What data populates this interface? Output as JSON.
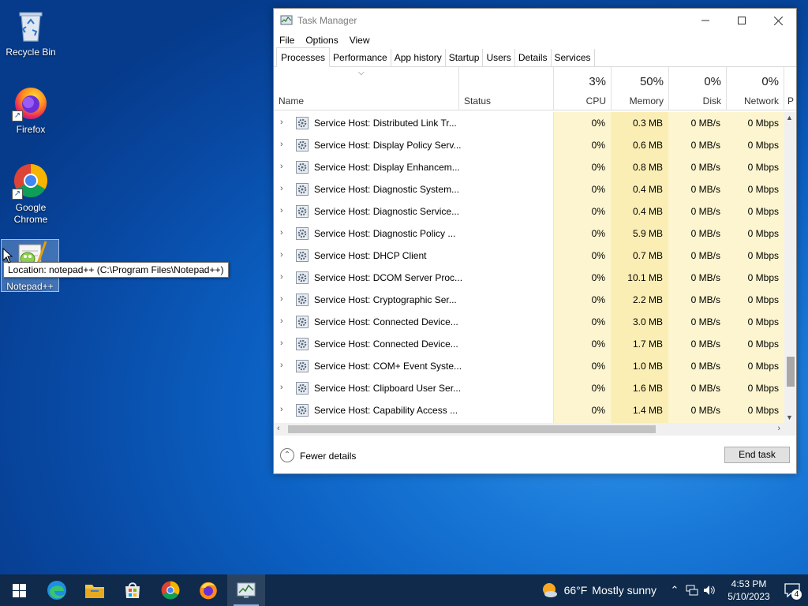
{
  "desktop": {
    "icons": [
      {
        "label": "Recycle Bin"
      },
      {
        "label": "Firefox"
      },
      {
        "label": "Google Chrome"
      },
      {
        "label": "Notepad++"
      }
    ],
    "tooltip": "Location: notepad++ (C:\\Program Files\\Notepad++)"
  },
  "taskmanager": {
    "title": "Task Manager",
    "menu": [
      "File",
      "Options",
      "View"
    ],
    "tabs": [
      "Processes",
      "Performance",
      "App history",
      "Startup",
      "Users",
      "Details",
      "Services"
    ],
    "active_tab": "Processes",
    "columns": {
      "name": "Name",
      "status": "Status",
      "cpu": {
        "pct": "3%",
        "label": "CPU"
      },
      "memory": {
        "pct": "50%",
        "label": "Memory"
      },
      "disk": {
        "pct": "0%",
        "label": "Disk"
      },
      "network": {
        "pct": "0%",
        "label": "Network"
      },
      "power": {
        "label": "P"
      }
    },
    "rows": [
      {
        "name": "Service Host: Distributed Link Tr...",
        "cpu": "0%",
        "memory": "0.3 MB",
        "disk": "0 MB/s",
        "network": "0 Mbps"
      },
      {
        "name": "Service Host: Display Policy Serv...",
        "cpu": "0%",
        "memory": "0.6 MB",
        "disk": "0 MB/s",
        "network": "0 Mbps"
      },
      {
        "name": "Service Host: Display Enhancem...",
        "cpu": "0%",
        "memory": "0.8 MB",
        "disk": "0 MB/s",
        "network": "0 Mbps"
      },
      {
        "name": "Service Host: Diagnostic System...",
        "cpu": "0%",
        "memory": "0.4 MB",
        "disk": "0 MB/s",
        "network": "0 Mbps"
      },
      {
        "name": "Service Host: Diagnostic Service...",
        "cpu": "0%",
        "memory": "0.4 MB",
        "disk": "0 MB/s",
        "network": "0 Mbps"
      },
      {
        "name": "Service Host: Diagnostic Policy ...",
        "cpu": "0%",
        "memory": "5.9 MB",
        "disk": "0 MB/s",
        "network": "0 Mbps"
      },
      {
        "name": "Service Host: DHCP Client",
        "cpu": "0%",
        "memory": "0.7 MB",
        "disk": "0 MB/s",
        "network": "0 Mbps"
      },
      {
        "name": "Service Host: DCOM Server Proc...",
        "cpu": "0%",
        "memory": "10.1 MB",
        "disk": "0 MB/s",
        "network": "0 Mbps"
      },
      {
        "name": "Service Host: Cryptographic Ser...",
        "cpu": "0%",
        "memory": "2.2 MB",
        "disk": "0 MB/s",
        "network": "0 Mbps"
      },
      {
        "name": "Service Host: Connected Device...",
        "cpu": "0%",
        "memory": "3.0 MB",
        "disk": "0 MB/s",
        "network": "0 Mbps"
      },
      {
        "name": "Service Host: Connected Device...",
        "cpu": "0%",
        "memory": "1.7 MB",
        "disk": "0 MB/s",
        "network": "0 Mbps"
      },
      {
        "name": "Service Host: COM+ Event Syste...",
        "cpu": "0%",
        "memory": "1.0 MB",
        "disk": "0 MB/s",
        "network": "0 Mbps"
      },
      {
        "name": "Service Host: Clipboard User Ser...",
        "cpu": "0%",
        "memory": "1.6 MB",
        "disk": "0 MB/s",
        "network": "0 Mbps"
      },
      {
        "name": "Service Host: Capability Access ...",
        "cpu": "0%",
        "memory": "1.4 MB",
        "disk": "0 MB/s",
        "network": "0 Mbps"
      }
    ],
    "footer": {
      "fewer_details": "Fewer details",
      "end_task": "End task"
    }
  },
  "taskbar": {
    "apps": [
      "start-icon",
      "edge-icon",
      "file-explorer-icon",
      "store-icon",
      "chrome-icon",
      "firefox-icon",
      "task-manager-icon"
    ],
    "weather": {
      "temp": "66°F",
      "condition": "Mostly sunny"
    },
    "time": "4:53 PM",
    "date": "5/10/2023",
    "notification_count": "4"
  },
  "colors": {
    "taskbar": "#0f2a4a",
    "cpu_shade": "#fcf5cf",
    "memory_shade": "#fbeeb5",
    "wallpaper": "#0b5fc1"
  }
}
